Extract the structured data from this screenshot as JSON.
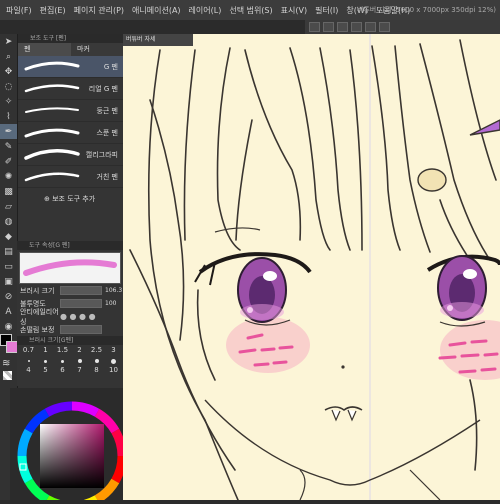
{
  "menubar": {
    "items": [
      "파일(F)",
      "편집(E)",
      "페이지 관리(P)",
      "애니메이션(A)",
      "레이어(L)",
      "선택 범위(S)",
      "표시(V)",
      "필터(I)",
      "창(W)",
      "도움말(H)"
    ],
    "title": "버튜버 자세 (5000 x 7000px 350dpi 12%)"
  },
  "subtool_panel": {
    "title": "보조 도구 [펜]",
    "tabs": [
      "펜",
      "마커"
    ],
    "brushes": [
      {
        "label": "G 펜",
        "selected": true
      },
      {
        "label": "리얼 G 펜",
        "selected": false
      },
      {
        "label": "둥근 펜",
        "selected": false
      },
      {
        "label": "스푼 펜",
        "selected": false
      },
      {
        "label": "캘리그라피",
        "selected": false
      },
      {
        "label": "거친 펜",
        "selected": false
      }
    ],
    "add_label": "보조 도구 추가"
  },
  "tool_property": {
    "title": "도구 속성[G 펜]",
    "rows": [
      {
        "label": "브러시 크기",
        "value": "106.3"
      },
      {
        "label": "불투명도",
        "value": "100"
      },
      {
        "label": "안티에일리어싱",
        "value": ""
      },
      {
        "label": "손떨림 보정",
        "value": ""
      }
    ]
  },
  "brush_size": {
    "title": "브러시 크기[G펜]",
    "row1": [
      "0.7",
      "1",
      "1.5",
      "2",
      "2.5",
      "3"
    ],
    "row2": [
      "4",
      "5",
      "6",
      "7",
      "8",
      "10"
    ]
  },
  "canvas": {
    "tab_label": "버튜버 자세"
  },
  "colors": {
    "main": "#000000",
    "sub": "#e57bd4",
    "canvas_bg": "#fcf5d7",
    "accent": "#596a7d"
  },
  "icons": [
    "cursor-icon",
    "zoom-icon",
    "move-icon",
    "lasso-icon",
    "eyedropper-icon",
    "pen-icon",
    "pencil-icon",
    "brush-icon",
    "airbrush-icon",
    "eraser-icon",
    "fill-icon",
    "text-icon"
  ]
}
